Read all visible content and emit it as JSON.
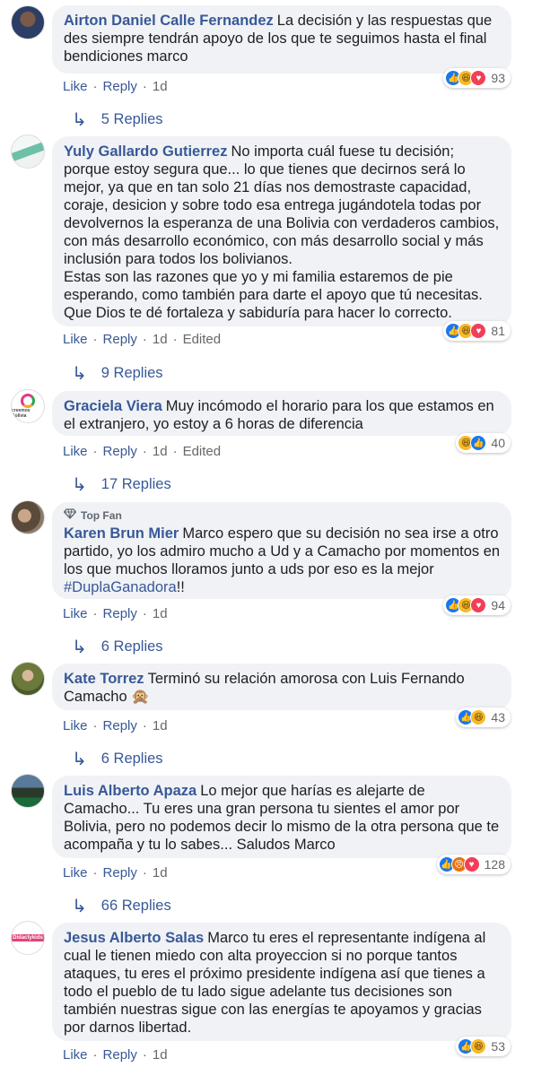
{
  "labels": {
    "like": "Like",
    "reply": "Reply",
    "edited": "Edited",
    "top_fan": "Top Fan"
  },
  "comments": [
    {
      "author": "Airton Daniel Calle Fernandez",
      "text": "La decisión y las respuestas que des siempre tendrán apoyo de los que te seguimos hasta el final bendiciones marco",
      "time": "1d",
      "reaction_count": "93",
      "replies": "5 Replies"
    },
    {
      "author": "Yuly Gallardo Gutierrez",
      "text": "No importa cuál fuese tu decisión; porque estoy segura que... lo que tienes que decirnos será lo mejor, ya que en tan solo 21 días nos demostraste capacidad, coraje, desicion y sobre todo esa entrega jugándotela todas por devolvernos la esperanza de una Bolivia con verdaderos cambios, con más desarrollo económico, con más desarrollo social y más inclusión para todos los bolivianos.",
      "text2": "Estas son las razones que yo y mi familia estaremos de pie esperando, como también para darte el apoyo que tú necesitas. Que Dios te dé fortaleza y sabiduría para hacer lo correcto.",
      "time": "1d",
      "reaction_count": "81",
      "replies": "9 Replies"
    },
    {
      "author": "Graciela Viera",
      "text": "Muy incómodo el horario para los que estamos en el extranjero, yo estoy a 6 horas de diferencia",
      "time": "1d",
      "reaction_count": "40",
      "replies": "17 Replies",
      "avatar_text": "creemos Bolivia"
    },
    {
      "author": "Karen Brun Mier",
      "text": "Marco espero que su decisión no sea irse a otro partido, yo los admiro mucho a Ud y a Camacho por momentos en los que muchos lloramos junto a uds por eso es la mejor ",
      "hashtag": "#DuplaGanadora",
      "text_end": "!!",
      "time": "1d",
      "reaction_count": "94",
      "replies": "6 Replies"
    },
    {
      "author": "Kate Torrez",
      "text": "Terminó su relación amorosa con Luis Fernando Camacho 🙊",
      "time": "1d",
      "reaction_count": "43",
      "replies": "6 Replies"
    },
    {
      "author": "Luis Alberto Apaza",
      "text": "Lo mejor que harías es alejarte de Camacho... Tu eres una gran persona tu sientes el amor por Bolivia, pero no podemos decir lo mismo de la otra persona que te acompaña y tu lo sabes... Saludos Marco",
      "time": "1d",
      "reaction_count": "128",
      "replies": "66 Replies"
    },
    {
      "author": "Jesus Alberto Salas",
      "text": "Marco tu eres el representante indígena al cual le tienen miedo con alta proyeccion si no porque tantos ataques, tu eres el próximo presidente indígena así que tienes a todo el pueblo de tu lado sigue adelante tus decisiones son también nuestras sigue con las energías te apoyamos y gracias por darnos libertad.",
      "time": "1d",
      "reaction_count": "53",
      "avatar_text": "Didactykids"
    }
  ],
  "colors": {
    "link": "#385898",
    "bubble": "#f0f2f5",
    "meta": "#65676b",
    "like": "#1877f2",
    "haha": "#f7b928",
    "love": "#f33e58",
    "angry": "#e9710f"
  }
}
